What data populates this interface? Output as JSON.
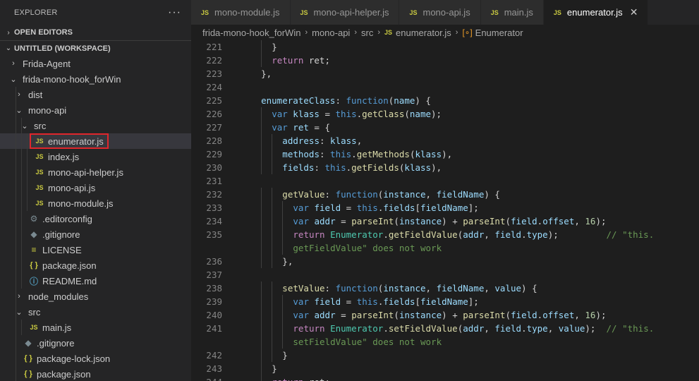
{
  "explorer": {
    "title": "EXPLORER",
    "more_label": "···",
    "open_editors_label": "OPEN EDITORS",
    "workspace_label": "UNTITLED (WORKSPACE)",
    "tree": [
      {
        "label": "Frida-Agent",
        "kind": "folder",
        "expanded": false,
        "depth": 0
      },
      {
        "label": "frida-mono-hook_forWin",
        "kind": "folder",
        "expanded": true,
        "depth": 0
      },
      {
        "label": "dist",
        "kind": "folder",
        "expanded": false,
        "depth": 1
      },
      {
        "label": "mono-api",
        "kind": "folder",
        "expanded": true,
        "depth": 1
      },
      {
        "label": "src",
        "kind": "folder",
        "expanded": true,
        "depth": 2
      },
      {
        "label": "enumerator.js",
        "kind": "js",
        "depth": 3,
        "selected": true
      },
      {
        "label": "index.js",
        "kind": "js",
        "depth": 3
      },
      {
        "label": "mono-api-helper.js",
        "kind": "js",
        "depth": 3
      },
      {
        "label": "mono-api.js",
        "kind": "js",
        "depth": 3
      },
      {
        "label": "mono-module.js",
        "kind": "js",
        "depth": 3
      },
      {
        "label": ".editorconfig",
        "kind": "cfg",
        "depth": 2
      },
      {
        "label": ".gitignore",
        "kind": "git",
        "depth": 2
      },
      {
        "label": "LICENSE",
        "kind": "lic",
        "depth": 2
      },
      {
        "label": "package.json",
        "kind": "json",
        "depth": 2
      },
      {
        "label": "README.md",
        "kind": "md",
        "depth": 2
      },
      {
        "label": "node_modules",
        "kind": "folder",
        "expanded": false,
        "depth": 1
      },
      {
        "label": "src",
        "kind": "folder",
        "expanded": true,
        "depth": 1
      },
      {
        "label": "main.js",
        "kind": "js",
        "depth": 2
      },
      {
        "label": ".gitignore",
        "kind": "git",
        "depth": 1
      },
      {
        "label": "package-lock.json",
        "kind": "json",
        "depth": 1
      },
      {
        "label": "package.json",
        "kind": "json",
        "depth": 1
      }
    ]
  },
  "tabs": [
    {
      "label": "mono-module.js",
      "active": false
    },
    {
      "label": "mono-api-helper.js",
      "active": false
    },
    {
      "label": "mono-api.js",
      "active": false
    },
    {
      "label": "main.js",
      "active": false
    },
    {
      "label": "enumerator.js",
      "active": true
    }
  ],
  "tab_close_glyph": "✕",
  "breadcrumb": {
    "parts": [
      "frida-mono-hook_forWin",
      "mono-api",
      "src",
      "enumerator.js",
      "Enumerator"
    ]
  },
  "icons": {
    "js": "JS",
    "json": "{ }",
    "chevron_right": "›",
    "chevron_down": "⌄",
    "class": "[∘]"
  },
  "colors": {
    "keyword": "#569cd6",
    "control": "#c586c0",
    "function": "#dcdcaa",
    "variable": "#9cdcfe",
    "class": "#4ec9b0",
    "number": "#b5cea8",
    "comment": "#6a9955",
    "highlight_box": "#e0262c"
  },
  "code_lines": [
    {
      "n": "221",
      "indent": 2,
      "tokens": [
        [
          "p",
          "}"
        ]
      ]
    },
    {
      "n": "222",
      "indent": 2,
      "tokens": [
        [
          "kw2",
          "return"
        ],
        [
          "p",
          " ret;"
        ]
      ]
    },
    {
      "n": "223",
      "indent": 1,
      "tokens": [
        [
          "p",
          "},"
        ]
      ]
    },
    {
      "n": "224",
      "indent": 0,
      "tokens": []
    },
    {
      "n": "225",
      "indent": 1,
      "tokens": [
        [
          "var",
          "enumerateClass"
        ],
        [
          "p",
          ": "
        ],
        [
          "kw",
          "function"
        ],
        [
          "p",
          "("
        ],
        [
          "var",
          "name"
        ],
        [
          "p",
          ") {"
        ]
      ]
    },
    {
      "n": "226",
      "indent": 2,
      "tokens": [
        [
          "kw",
          "var"
        ],
        [
          "p",
          " "
        ],
        [
          "var",
          "klass"
        ],
        [
          "p",
          " = "
        ],
        [
          "kw",
          "this"
        ],
        [
          "p",
          "."
        ],
        [
          "fn",
          "getClass"
        ],
        [
          "p",
          "("
        ],
        [
          "var",
          "name"
        ],
        [
          "p",
          ");"
        ]
      ]
    },
    {
      "n": "227",
      "indent": 2,
      "tokens": [
        [
          "kw",
          "var"
        ],
        [
          "p",
          " "
        ],
        [
          "var",
          "ret"
        ],
        [
          "p",
          " = {"
        ]
      ]
    },
    {
      "n": "228",
      "indent": 3,
      "tokens": [
        [
          "var",
          "address"
        ],
        [
          "p",
          ": "
        ],
        [
          "var",
          "klass"
        ],
        [
          "p",
          ","
        ]
      ]
    },
    {
      "n": "229",
      "indent": 3,
      "tokens": [
        [
          "var",
          "methods"
        ],
        [
          "p",
          ": "
        ],
        [
          "kw",
          "this"
        ],
        [
          "p",
          "."
        ],
        [
          "fn",
          "getMethods"
        ],
        [
          "p",
          "("
        ],
        [
          "var",
          "klass"
        ],
        [
          "p",
          "),"
        ]
      ]
    },
    {
      "n": "230",
      "indent": 3,
      "tokens": [
        [
          "var",
          "fields"
        ],
        [
          "p",
          ": "
        ],
        [
          "kw",
          "this"
        ],
        [
          "p",
          "."
        ],
        [
          "fn",
          "getFields"
        ],
        [
          "p",
          "("
        ],
        [
          "var",
          "klass"
        ],
        [
          "p",
          "),"
        ]
      ]
    },
    {
      "n": "231",
      "indent": 0,
      "tokens": []
    },
    {
      "n": "232",
      "indent": 3,
      "tokens": [
        [
          "fn",
          "getValue"
        ],
        [
          "p",
          ": "
        ],
        [
          "kw",
          "function"
        ],
        [
          "p",
          "("
        ],
        [
          "var",
          "instance"
        ],
        [
          "p",
          ", "
        ],
        [
          "var",
          "fieldName"
        ],
        [
          "p",
          ") {"
        ]
      ]
    },
    {
      "n": "233",
      "indent": 4,
      "tokens": [
        [
          "kw",
          "var"
        ],
        [
          "p",
          " "
        ],
        [
          "var",
          "field"
        ],
        [
          "p",
          " = "
        ],
        [
          "kw",
          "this"
        ],
        [
          "p",
          "."
        ],
        [
          "var",
          "fields"
        ],
        [
          "p",
          "["
        ],
        [
          "var",
          "fieldName"
        ],
        [
          "p",
          "];"
        ]
      ]
    },
    {
      "n": "234",
      "indent": 4,
      "tokens": [
        [
          "kw",
          "var"
        ],
        [
          "p",
          " "
        ],
        [
          "var",
          "addr"
        ],
        [
          "p",
          " = "
        ],
        [
          "fn",
          "parseInt"
        ],
        [
          "p",
          "("
        ],
        [
          "var",
          "instance"
        ],
        [
          "p",
          ") + "
        ],
        [
          "fn",
          "parseInt"
        ],
        [
          "p",
          "("
        ],
        [
          "var",
          "field"
        ],
        [
          "p",
          "."
        ],
        [
          "var",
          "offset"
        ],
        [
          "p",
          ", "
        ],
        [
          "num",
          "16"
        ],
        [
          "p",
          ");"
        ]
      ]
    },
    {
      "n": "235",
      "indent": 4,
      "tokens": [
        [
          "kw2",
          "return"
        ],
        [
          "p",
          " "
        ],
        [
          "cls2",
          "Enumerator"
        ],
        [
          "p",
          "."
        ],
        [
          "fn",
          "getFieldValue"
        ],
        [
          "p",
          "("
        ],
        [
          "var",
          "addr"
        ],
        [
          "p",
          ", "
        ],
        [
          "var",
          "field"
        ],
        [
          "p",
          "."
        ],
        [
          "var",
          "type"
        ],
        [
          "p",
          ");         "
        ],
        [
          "cm",
          "// \"this."
        ]
      ]
    },
    {
      "n": "",
      "indent": 4,
      "tokens": [
        [
          "cm",
          "getFieldValue\" does not work"
        ]
      ]
    },
    {
      "n": "236",
      "indent": 3,
      "tokens": [
        [
          "p",
          "},"
        ]
      ]
    },
    {
      "n": "237",
      "indent": 0,
      "tokens": []
    },
    {
      "n": "238",
      "indent": 3,
      "tokens": [
        [
          "fn",
          "setValue"
        ],
        [
          "p",
          ": "
        ],
        [
          "kw",
          "function"
        ],
        [
          "p",
          "("
        ],
        [
          "var",
          "instance"
        ],
        [
          "p",
          ", "
        ],
        [
          "var",
          "fieldName"
        ],
        [
          "p",
          ", "
        ],
        [
          "var",
          "value"
        ],
        [
          "p",
          ") {"
        ]
      ]
    },
    {
      "n": "239",
      "indent": 4,
      "tokens": [
        [
          "kw",
          "var"
        ],
        [
          "p",
          " "
        ],
        [
          "var",
          "field"
        ],
        [
          "p",
          " = "
        ],
        [
          "kw",
          "this"
        ],
        [
          "p",
          "."
        ],
        [
          "var",
          "fields"
        ],
        [
          "p",
          "["
        ],
        [
          "var",
          "fieldName"
        ],
        [
          "p",
          "];"
        ]
      ]
    },
    {
      "n": "240",
      "indent": 4,
      "tokens": [
        [
          "kw",
          "var"
        ],
        [
          "p",
          " "
        ],
        [
          "var",
          "addr"
        ],
        [
          "p",
          " = "
        ],
        [
          "fn",
          "parseInt"
        ],
        [
          "p",
          "("
        ],
        [
          "var",
          "instance"
        ],
        [
          "p",
          ") + "
        ],
        [
          "fn",
          "parseInt"
        ],
        [
          "p",
          "("
        ],
        [
          "var",
          "field"
        ],
        [
          "p",
          "."
        ],
        [
          "var",
          "offset"
        ],
        [
          "p",
          ", "
        ],
        [
          "num",
          "16"
        ],
        [
          "p",
          ");"
        ]
      ]
    },
    {
      "n": "241",
      "indent": 4,
      "tokens": [
        [
          "kw2",
          "return"
        ],
        [
          "p",
          " "
        ],
        [
          "cls2",
          "Enumerator"
        ],
        [
          "p",
          "."
        ],
        [
          "fn",
          "setFieldValue"
        ],
        [
          "p",
          "("
        ],
        [
          "var",
          "addr"
        ],
        [
          "p",
          ", "
        ],
        [
          "var",
          "field"
        ],
        [
          "p",
          "."
        ],
        [
          "var",
          "type"
        ],
        [
          "p",
          ", "
        ],
        [
          "var",
          "value"
        ],
        [
          "p",
          ");  "
        ],
        [
          "cm",
          "// \"this."
        ]
      ]
    },
    {
      "n": "",
      "indent": 4,
      "tokens": [
        [
          "cm",
          "setFieldValue\" does not work"
        ]
      ]
    },
    {
      "n": "242",
      "indent": 3,
      "tokens": [
        [
          "p",
          "}"
        ]
      ]
    },
    {
      "n": "243",
      "indent": 2,
      "tokens": [
        [
          "p",
          "}"
        ]
      ]
    },
    {
      "n": "244",
      "indent": 2,
      "tokens": [
        [
          "kw2",
          "return"
        ],
        [
          "p",
          " ret;"
        ]
      ]
    }
  ]
}
